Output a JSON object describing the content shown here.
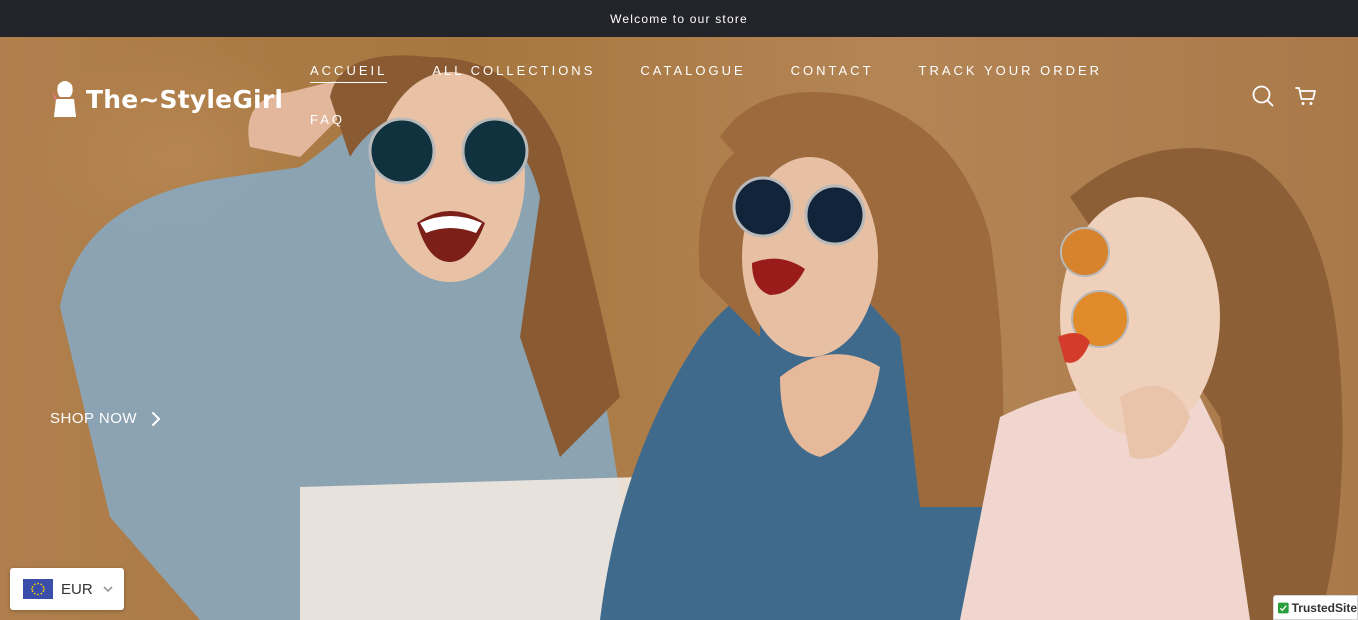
{
  "announcement": {
    "text": "Welcome to our store"
  },
  "header": {
    "logo_text": "The~StyleGirl",
    "nav": [
      {
        "label": "ACCUEIL",
        "active": true
      },
      {
        "label": "ALL COLLECTIONS"
      },
      {
        "label": "CATALOGUE"
      },
      {
        "label": "CONTACT"
      },
      {
        "label": "TRACK YOUR ORDER"
      }
    ],
    "nav_second_row": [
      {
        "label": "FAQ"
      }
    ],
    "icons": {
      "search": "search-icon",
      "cart": "cart-icon"
    }
  },
  "hero": {
    "image": "three-women-laughing-sunglasses-photo",
    "cta_label": "SHOP NOW",
    "cta_icon": "chevron-right-icon"
  },
  "currency": {
    "code": "EUR",
    "flag": "eu-flag-icon"
  },
  "trust_badge": {
    "text": "TrustedSite"
  },
  "colors": {
    "announcement_bg": "#23242a",
    "hero_bg": "#a97c4f",
    "text": "#ffffff"
  }
}
